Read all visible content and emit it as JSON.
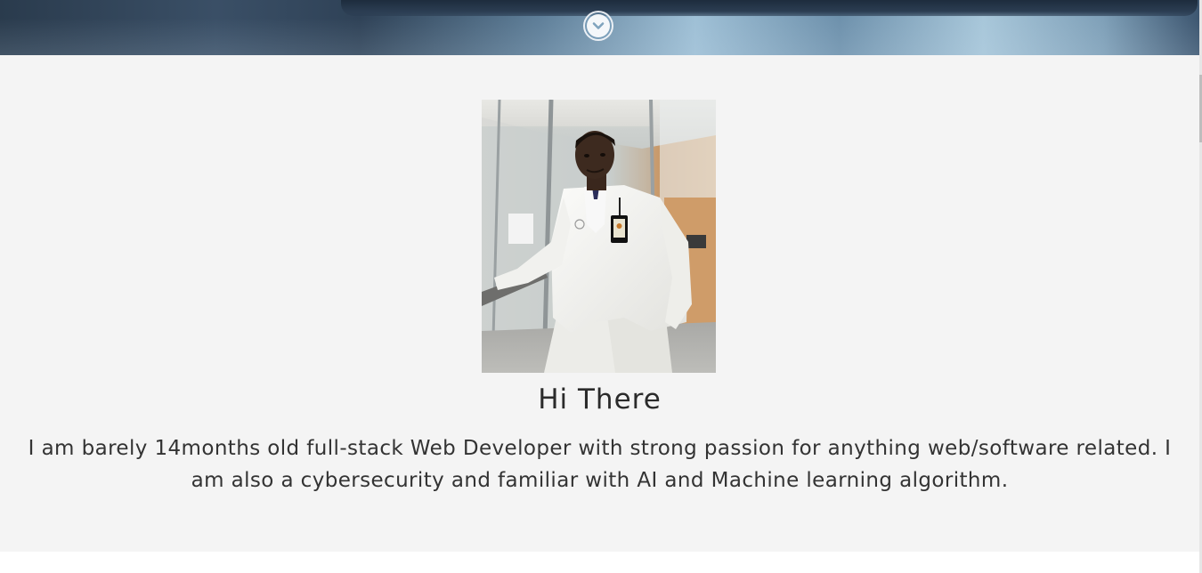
{
  "hero": {
    "scroll_icon": "chevron-down-icon"
  },
  "about": {
    "photo_alt": "Profile photo",
    "heading": "Hi There",
    "intro": "I am barely 14months old full-stack Web Developer with strong passion for anything web/software related. I am also a cybersecurity and familiar with AI and Machine learning algorithm."
  },
  "colors": {
    "section_background": "#f4f4f4",
    "text": "#333333",
    "hero_accent": "#9fc0d6"
  }
}
